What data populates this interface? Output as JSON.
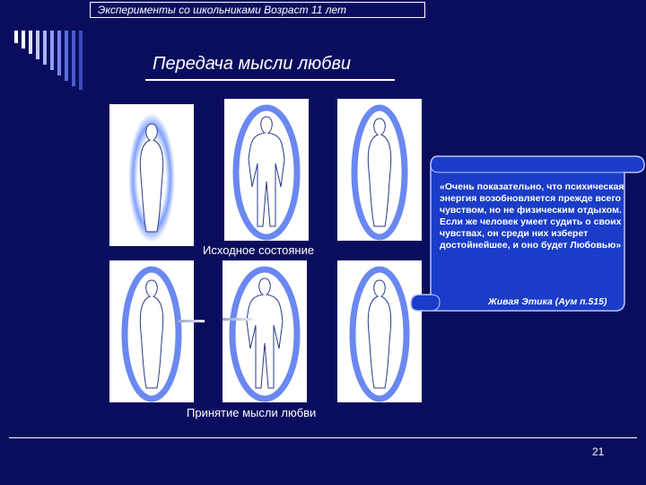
{
  "header": {
    "text": "Эксперименты со школьниками Возраст 11 лет"
  },
  "title": "Передача мысли любви",
  "captions": {
    "initial": "Исходное состояние",
    "accepted": "Принятие мысли любви"
  },
  "quote": {
    "text": "«Очень показательно, что психическая энергия возобновляется прежде всего чувством, но не физическим отдыхом. Если же человек умеет судить о своих чувствах, он среди них изберет достойнейшее, и оно будет Любовью»",
    "source": "Живая Этика (Аум п.515)"
  },
  "page_number": "21",
  "colors": {
    "background": "#0a0d5e",
    "scroll": "#1a3cc8",
    "aura": "#3a63e6"
  }
}
